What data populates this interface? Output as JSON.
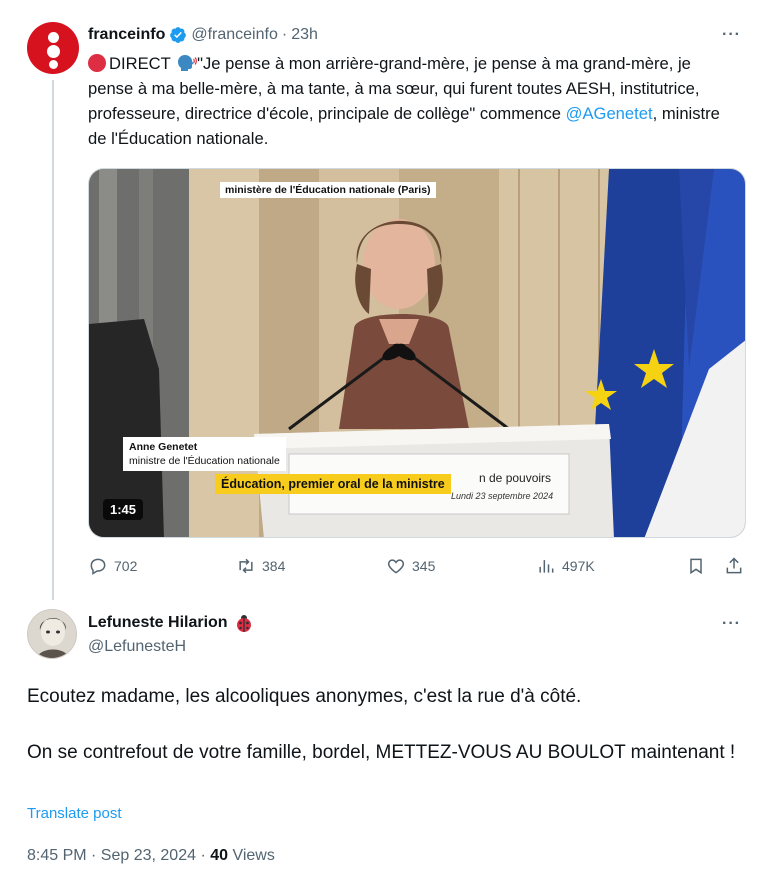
{
  "parent_tweet": {
    "author_name": "franceinfo",
    "handle": "@franceinfo",
    "time": "23h",
    "separator": "·",
    "more": "···",
    "text_live": "DIRECT",
    "text_quote": "\"Je pense à mon arrière-grand-mère, je pense à ma grand-mère, je pense à ma belle-mère, à ma tante, à ma sœur, qui furent toutes AESH, institutrice, professeure, directrice d'école, principale de collège\" commence ",
    "mention": "@AGenetet",
    "text_tail": ", ministre de l'Éducation nationale.",
    "media": {
      "location_tag": "ministère de l'Éducation nationale (Paris)",
      "name_tag_name": "Anne Genetet",
      "name_tag_title": "ministre de l'Éducation nationale",
      "banner": "Éducation, premier oral de la ministre",
      "podium_text": "n de pouvoirs",
      "podium_date": "Lundi 23 septembre 2024",
      "duration": "1:45"
    },
    "actions": {
      "replies": "702",
      "reposts": "384",
      "likes": "345",
      "views": "497K"
    }
  },
  "reply_tweet": {
    "author_name": "Lefuneste Hilarion",
    "handle": "@LefunesteH",
    "more": "···",
    "paragraph1": "Ecoutez madame, les alcooliques anonymes, c'est la rue d'à côté.",
    "paragraph2": "On se contrefout de votre famille, bordel, METTEZ-VOUS AU BOULOT maintenant !",
    "translate": "Translate post",
    "timestamp": "8:45 PM · Sep 23, 2024 · ",
    "views_count": "40",
    "views_label": " Views"
  },
  "colors": {
    "accent": "#1d9bf0",
    "secondary_text": "#536471",
    "brand_red": "#d5121e",
    "banner_yellow": "#f7cc1c"
  }
}
